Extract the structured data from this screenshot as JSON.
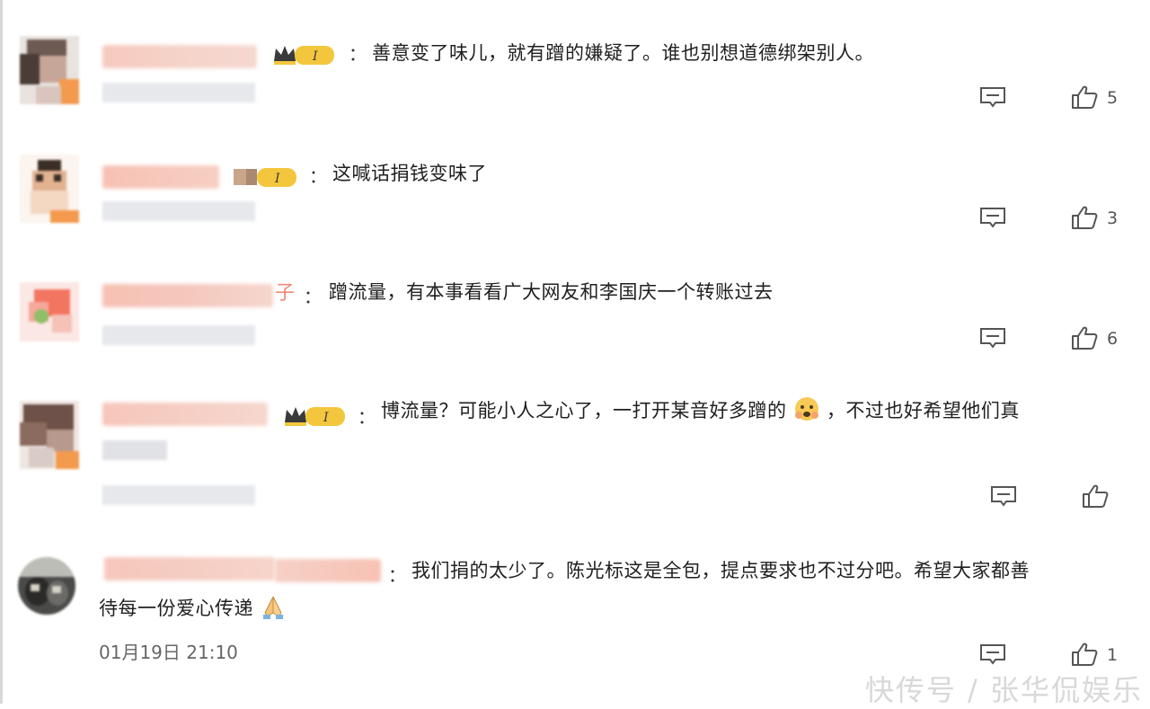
{
  "comments": [
    {
      "text": "善意变了味儿，就有蹭的嫌疑了。谁也别想道德绑架别人。",
      "colon": "：",
      "likes": "5"
    },
    {
      "text": "这喊话捐钱变味了",
      "colon": "：",
      "likes": "3"
    },
    {
      "name_suffix": "子",
      "text": "蹭流量，有本事看看广大网友和李国庆一个转账过去",
      "colon": "：",
      "likes": "6"
    },
    {
      "text_before": "博流量？可能小人之心了，一打开某音好多蹭的",
      "text_after": "，不过也好希望他们真",
      "colon": "："
    },
    {
      "text_line1": "我们捐的太少了。陈光标这是全包，提点要求也不过分吧。希望大家都善",
      "text_line2": "待每一份爱心传递",
      "colon": "：",
      "timestamp": "01月19日 21:10",
      "likes": "1"
    }
  ],
  "badge": {
    "level_label": "I"
  },
  "icons": {
    "reply": "reply-icon",
    "like": "thumbs-up-icon",
    "crown": "crown-icon",
    "emoji_face": "emoji-face-icon",
    "emoji_pray": "praying-hands-icon"
  },
  "colors": {
    "badge_gold": "#f4c63d",
    "crown_dark": "#3a3a3a",
    "icon_gray": "#666666"
  },
  "watermark": "快传号 / 张华侃娱乐"
}
